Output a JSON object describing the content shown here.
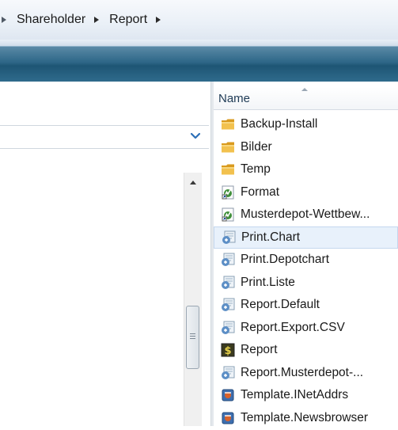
{
  "breadcrumb": {
    "items": [
      {
        "label": "Shareholder"
      },
      {
        "label": "Report"
      }
    ]
  },
  "file_list": {
    "column_header": "Name",
    "items": [
      {
        "name": "Backup-Install",
        "icon": "folder-icon"
      },
      {
        "name": "Bilder",
        "icon": "folder-icon"
      },
      {
        "name": "Temp",
        "icon": "folder-icon"
      },
      {
        "name": "Format",
        "icon": "shortcut-file-icon"
      },
      {
        "name": "Musterdepot-Wettbew...",
        "icon": "shortcut-file-icon"
      },
      {
        "name": "Print.Chart",
        "icon": "script-file-icon",
        "selected": true
      },
      {
        "name": "Print.Depotchart",
        "icon": "script-file-icon"
      },
      {
        "name": "Print.Liste",
        "icon": "script-file-icon"
      },
      {
        "name": "Report.Default",
        "icon": "script-file-icon"
      },
      {
        "name": "Report.Export.CSV",
        "icon": "script-file-icon"
      },
      {
        "name": "Report",
        "icon": "app-file-icon"
      },
      {
        "name": "Report.Musterdepot-...",
        "icon": "script-file-icon"
      },
      {
        "name": "Template.INetAddrs",
        "icon": "template-file-icon"
      },
      {
        "name": "Template.Newsbrowser",
        "icon": "template-file-icon"
      }
    ]
  },
  "colors": {
    "toolbar": "#2d6687",
    "folder": "#e8b33a",
    "selection": "#e8f1fb",
    "header_text": "#1e3a55"
  }
}
